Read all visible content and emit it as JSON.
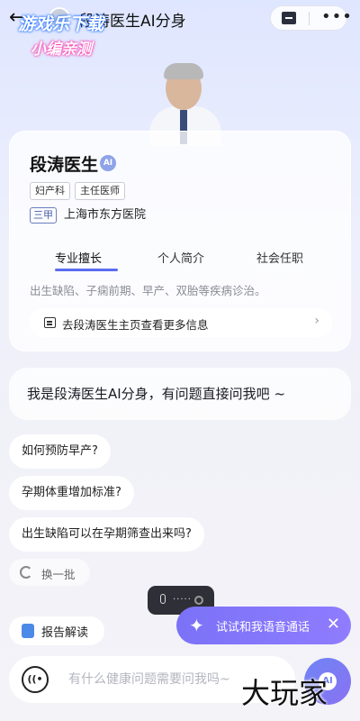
{
  "header": {
    "title": "段涛医生AI分身",
    "back_icon": "arrow-left-icon",
    "file_icon": "folder-icon",
    "more_icon": "more-dots-icon"
  },
  "watermarks": {
    "top_line1": "游戏乐下载",
    "top_line2": "小编亲测",
    "bottom": "大玩家"
  },
  "doctor": {
    "name": "段涛医生",
    "ai_badge": "AI",
    "tags": [
      "妇产科",
      "主任医师"
    ],
    "hospital_grade": "三甲",
    "hospital": "上海市东方医院",
    "tabs": [
      {
        "label": "专业擅长",
        "active": true
      },
      {
        "label": "个人简介",
        "active": false
      },
      {
        "label": "社会任职",
        "active": false
      }
    ],
    "specialty": "出生缺陷、子痫前期、早产、双胎等疾病诊治。",
    "more_info_label": "去段涛医生主页查看更多信息"
  },
  "chat": {
    "greeting": "我是段涛医生AI分身，有问题直接问我吧 ~",
    "suggestions": [
      "如何预防早产?",
      "孕期体重增加标准?",
      "出生缺陷可以在孕期筛查出来吗?"
    ],
    "refresh_label": "换一批"
  },
  "bottom": {
    "report_label": "报告解读",
    "voice_tip": "试试和我语音通话",
    "input_placeholder": "有什么健康问题需要问我吗~",
    "ai_fab_label": "AI"
  },
  "colors": {
    "accent": "#5b6cf0",
    "voice_tip_bg": "#7b72f7",
    "recording_pill": "#2f3037"
  }
}
